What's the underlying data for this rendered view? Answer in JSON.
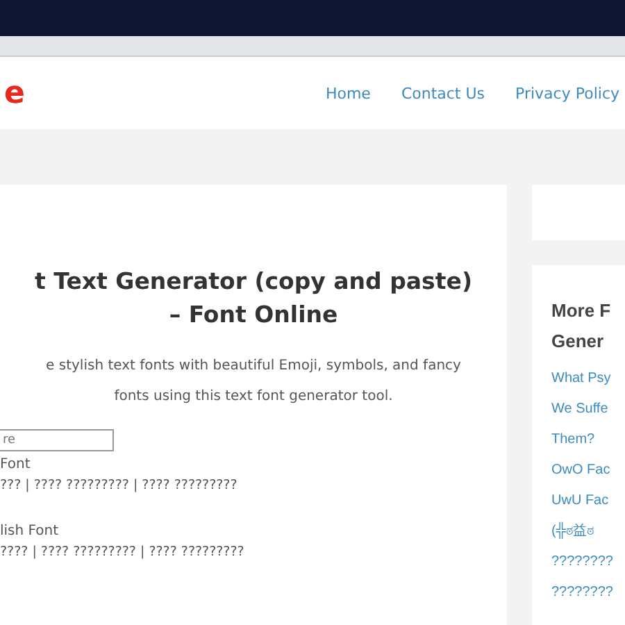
{
  "header": {
    "logo": "e",
    "nav": [
      {
        "label": "Home"
      },
      {
        "label": "Contact Us"
      },
      {
        "label": "Privacy Policy"
      }
    ]
  },
  "main": {
    "title_lines": [
      "t Text Generator (copy and paste)",
      "– Font Online"
    ],
    "intro_lines": [
      "e stylish text fonts with beautiful Emoji, symbols, and fancy",
      "fonts using this text font generator tool."
    ],
    "input": {
      "placeholder": "re"
    },
    "fonts": [
      {
        "name": "Font",
        "sample": "??? | ???? ????????? | ???? ?????????"
      },
      {
        "name": "lish Font",
        "sample": "???? | ???? ????????? | ???? ?????????"
      }
    ]
  },
  "sidebar": {
    "title_lines": [
      "More F",
      "Gener"
    ],
    "links": [
      {
        "label": "What Psy"
      },
      {
        "label": "We Suffe"
      },
      {
        "label": "Them?"
      },
      {
        "label": "OwO Fac"
      },
      {
        "label": "UwU Fac"
      },
      {
        "label": "(╬ಠ益ಠ"
      },
      {
        "label": "????????"
      },
      {
        "label": "????????"
      }
    ]
  }
}
